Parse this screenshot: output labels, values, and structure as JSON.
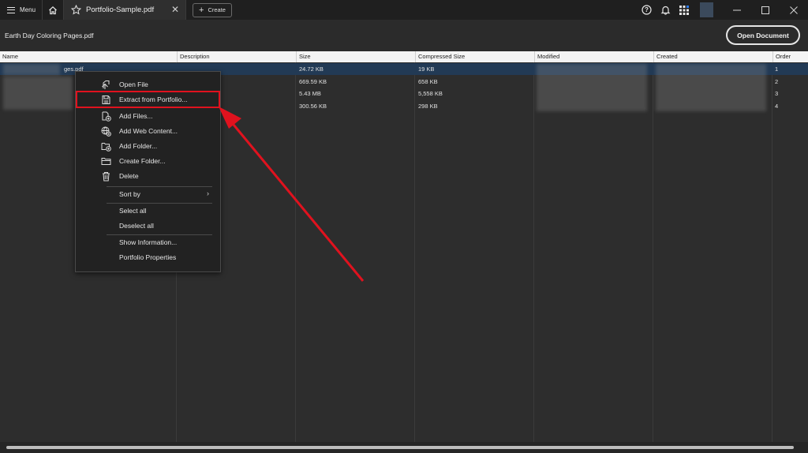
{
  "topbar": {
    "menu_label": "Menu",
    "tab_title": "Portfolio-Sample.pdf",
    "create_label": "Create"
  },
  "header": {
    "doc_title": "Earth Day Coloring Pages.pdf",
    "open_document_label": "Open Document"
  },
  "table": {
    "columns": [
      "Name",
      "Description",
      "Size",
      "Compressed Size",
      "Modified",
      "Created",
      "Order"
    ],
    "rows": [
      {
        "name": "ges.pdf",
        "size": "24.72 KB",
        "compressed": "19 KB",
        "order": "1",
        "selected": true
      },
      {
        "name": "",
        "size": "669.59 KB",
        "compressed": "658 KB",
        "order": "2",
        "selected": false
      },
      {
        "name": "",
        "size": "5.43 MB",
        "compressed": "5,558 KB",
        "order": "3",
        "selected": false
      },
      {
        "name": "",
        "size": "300.56 KB",
        "compressed": "298 KB",
        "order": "4",
        "selected": false
      }
    ]
  },
  "context_menu": {
    "items": [
      {
        "label": "Open File",
        "icon": "open-file-icon"
      },
      {
        "label": "Extract from Portfolio...",
        "icon": "extract-icon"
      },
      {
        "label": "Add Files...",
        "icon": "add-files-icon"
      },
      {
        "label": "Add Web Content...",
        "icon": "add-web-content-icon"
      },
      {
        "label": "Add Folder...",
        "icon": "add-folder-icon"
      },
      {
        "label": "Create Folder...",
        "icon": "create-folder-icon"
      },
      {
        "label": "Delete",
        "icon": "trash-icon"
      },
      {
        "label": "Sort by",
        "icon": ""
      },
      {
        "label": "Select all",
        "icon": ""
      },
      {
        "label": "Deselect all",
        "icon": ""
      },
      {
        "label": "Show Information...",
        "icon": ""
      },
      {
        "label": "Portfolio Properties",
        "icon": ""
      }
    ]
  },
  "colors": {
    "background": "#2b2b2b",
    "topbar": "#1f1f1f",
    "selected_row": "#223a55",
    "highlight": "#e0121e"
  }
}
